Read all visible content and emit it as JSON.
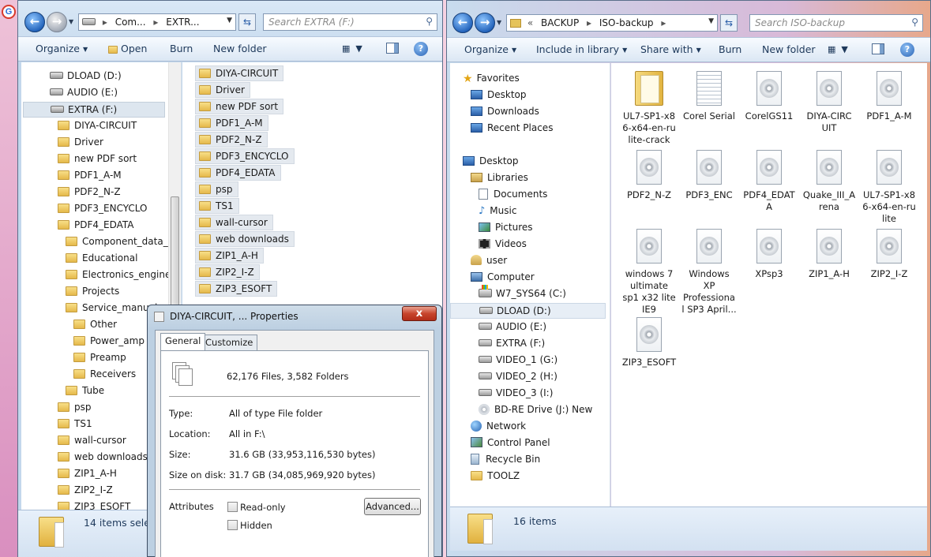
{
  "left_window": {
    "address": {
      "segments": [
        "Com...",
        "EXTR..."
      ],
      "separator": "▸"
    },
    "search_placeholder": "Search EXTRA (F:)",
    "toolbar": {
      "organize": "Organize",
      "open": "Open",
      "burn": "Burn",
      "new_folder": "New folder"
    },
    "tree": [
      {
        "label": "DLOAD (D:)",
        "type": "drive"
      },
      {
        "label": "AUDIO (E:)",
        "type": "drive"
      },
      {
        "label": "EXTRA (F:)",
        "type": "drive",
        "selected": true
      },
      {
        "label": "DIYA-CIRCUIT",
        "type": "folder"
      },
      {
        "label": "Driver",
        "type": "folder"
      },
      {
        "label": "new PDF sort",
        "type": "folder"
      },
      {
        "label": "PDF1_A-M",
        "type": "folder"
      },
      {
        "label": "PDF2_N-Z",
        "type": "folder"
      },
      {
        "label": "PDF3_ENCYCLO",
        "type": "folder"
      },
      {
        "label": "PDF4_EDATA",
        "type": "folder"
      },
      {
        "label": "Component_data_s",
        "type": "folder"
      },
      {
        "label": "Educational",
        "type": "folder"
      },
      {
        "label": "Electronics_enginee",
        "type": "folder"
      },
      {
        "label": "Projects",
        "type": "folder"
      },
      {
        "label": "Service_manuals",
        "type": "folder"
      },
      {
        "label": "Other",
        "type": "folder"
      },
      {
        "label": "Power_amp",
        "type": "folder"
      },
      {
        "label": "Preamp",
        "type": "folder"
      },
      {
        "label": "Receivers",
        "type": "folder"
      },
      {
        "label": "Tube",
        "type": "folder"
      },
      {
        "label": "psp",
        "type": "folder"
      },
      {
        "label": "TS1",
        "type": "folder"
      },
      {
        "label": "wall-cursor",
        "type": "folder"
      },
      {
        "label": "web downloads",
        "type": "folder"
      },
      {
        "label": "ZIP1_A-H",
        "type": "folder"
      },
      {
        "label": "ZIP2_I-Z",
        "type": "folder"
      },
      {
        "label": "ZIP3_ESOFT",
        "type": "folder"
      }
    ],
    "files": [
      "DIYA-CIRCUIT",
      "Driver",
      "new PDF sort",
      "PDF1_A-M",
      "PDF2_N-Z",
      "PDF3_ENCYCLO",
      "PDF4_EDATA",
      "psp",
      "TS1",
      "wall-cursor",
      "web downloads",
      "ZIP1_A-H",
      "ZIP2_I-Z",
      "ZIP3_ESOFT"
    ],
    "status": "14 items sele"
  },
  "right_window": {
    "address": {
      "segments": [
        "BACKUP",
        "ISO-backup"
      ],
      "prefix": "«",
      "separator": "▸"
    },
    "search_placeholder": "Search ISO-backup",
    "toolbar": {
      "organize": "Organize",
      "include_in_library": "Include in library",
      "share_with": "Share with",
      "burn": "Burn",
      "new_folder": "New folder"
    },
    "nav": [
      {
        "label": "Favorites",
        "icon": "star-icon"
      },
      {
        "label": "Desktop",
        "icon": "desktop-icon"
      },
      {
        "label": "Downloads",
        "icon": "downloads-icon"
      },
      {
        "label": "Recent Places",
        "icon": "recent-places-icon"
      },
      {
        "label": "Desktop",
        "icon": "desktop-icon"
      },
      {
        "label": "Libraries",
        "icon": "libraries-icon"
      },
      {
        "label": "Documents",
        "icon": "documents-icon"
      },
      {
        "label": "Music",
        "icon": "music-icon"
      },
      {
        "label": "Pictures",
        "icon": "pictures-icon"
      },
      {
        "label": "Videos",
        "icon": "videos-icon"
      },
      {
        "label": "user",
        "icon": "user-icon"
      },
      {
        "label": "Computer",
        "icon": "computer-icon"
      },
      {
        "label": "W7_SYS64 (C:)",
        "icon": "system-drive-icon"
      },
      {
        "label": "DLOAD (D:)",
        "icon": "drive-icon",
        "selected": true
      },
      {
        "label": "AUDIO (E:)",
        "icon": "drive-icon"
      },
      {
        "label": "EXTRA (F:)",
        "icon": "drive-icon"
      },
      {
        "label": "VIDEO_1 (G:)",
        "icon": "drive-icon"
      },
      {
        "label": "VIDEO_2 (H:)",
        "icon": "drive-icon"
      },
      {
        "label": "VIDEO_3 (I:)",
        "icon": "drive-icon"
      },
      {
        "label": "BD-RE Drive (J:) New",
        "icon": "bd-drive-icon"
      },
      {
        "label": "Network",
        "icon": "network-icon"
      },
      {
        "label": "Control Panel",
        "icon": "control-panel-icon"
      },
      {
        "label": "Recycle Bin",
        "icon": "recycle-bin-icon"
      },
      {
        "label": "TOOLZ",
        "icon": "folder-icon"
      }
    ],
    "files": [
      {
        "lines": [
          "UL7-SP1-x8",
          "6-x64-en-ru",
          "lite-crack"
        ],
        "icon": "folder"
      },
      {
        "lines": [
          "Corel Serial"
        ],
        "icon": "text"
      },
      {
        "lines": [
          "CorelGS11"
        ],
        "icon": "disc"
      },
      {
        "lines": [
          "DIYA-CIRC",
          "UIT"
        ],
        "icon": "disc"
      },
      {
        "lines": [
          "PDF1_A-M"
        ],
        "icon": "disc"
      },
      {
        "lines": [
          "PDF2_N-Z"
        ],
        "icon": "disc"
      },
      {
        "lines": [
          "PDF3_ENC"
        ],
        "icon": "disc"
      },
      {
        "lines": [
          "PDF4_EDAT",
          "A"
        ],
        "icon": "disc"
      },
      {
        "lines": [
          "Quake_III_A",
          "rena"
        ],
        "icon": "disc"
      },
      {
        "lines": [
          "UL7-SP1-x8",
          "6-x64-en-ru",
          "lite"
        ],
        "icon": "disc"
      },
      {
        "lines": [
          "windows 7",
          "ultimate",
          "sp1 x32 lite",
          "IE9"
        ],
        "icon": "disc"
      },
      {
        "lines": [
          "Windows",
          "XP",
          "Professiona",
          "l SP3 April..."
        ],
        "icon": "disc"
      },
      {
        "lines": [
          "XPsp3"
        ],
        "icon": "disc"
      },
      {
        "lines": [
          "ZIP1_A-H"
        ],
        "icon": "disc"
      },
      {
        "lines": [
          "ZIP2_I-Z"
        ],
        "icon": "disc"
      },
      {
        "lines": [
          "ZIP3_ESOFT"
        ],
        "icon": "disc"
      }
    ],
    "status": "16 items"
  },
  "dialog": {
    "title": "DIYA-CIRCUIT, ... Properties",
    "close": "x",
    "tabs": {
      "general": "General",
      "customize": "Customize"
    },
    "summary": "62,176 Files, 3,582 Folders",
    "type_label": "Type:",
    "type_value": "All of type File folder",
    "location_label": "Location:",
    "location_value": "All in F:\\",
    "size_label": "Size:",
    "size_value": "31.6 GB (33,953,116,530 bytes)",
    "size_on_disk_label": "Size on disk:",
    "size_on_disk_value": "31.7 GB (34,085,969,920 bytes)",
    "attributes_label": "Attributes",
    "readonly_label": "Read-only",
    "hidden_label": "Hidden",
    "advanced_button": "Advanced..."
  },
  "colors": {
    "window_frame": "#c3d7ec",
    "selection": "#dde6ef",
    "accent_blue": "#1e5fb8",
    "close_red": "#c7452c"
  }
}
